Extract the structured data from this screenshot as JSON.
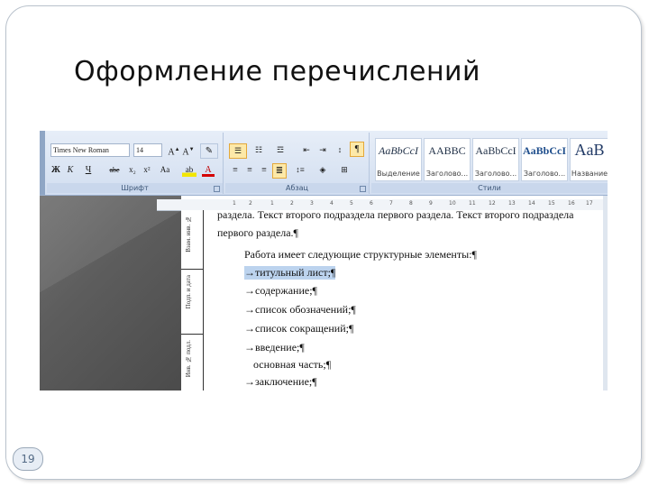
{
  "slide": {
    "title": "Оформление перечислений",
    "page_number": "19"
  },
  "ribbon": {
    "font_name": "Times New Roman",
    "font_size": "14",
    "groups": {
      "font_label": "Шрифт",
      "paragraph_label": "Абзац",
      "styles_label": "Стили"
    },
    "font_row2": [
      "Ж",
      "К",
      "Ч",
      "abe",
      "x₂",
      "x²",
      "Aa"
    ],
    "styles": [
      {
        "preview": "AaBbCcI",
        "name": "Выделение"
      },
      {
        "preview": "AABBC",
        "name": "Заголово..."
      },
      {
        "preview": "AaBbCcI",
        "name": "Заголово..."
      },
      {
        "preview": "AaBbCcI",
        "name": "Заголово..."
      },
      {
        "preview": "AaB",
        "name": "Название"
      }
    ]
  },
  "ruler": {
    "ticks": [
      "1",
      "2",
      "1",
      "2",
      "3",
      "4",
      "5",
      "6",
      "7",
      "8",
      "9",
      "10",
      "11",
      "12",
      "13",
      "14",
      "15",
      "16",
      "17"
    ]
  },
  "document": {
    "lines": [
      "раздела. Текст второго подраздела первого раздела. Текст второго подраздела",
      "первого раздела.¶",
      "Работа имеет следующие структурные элементы:¶",
      "→титульный лист;¶",
      "→содержание;¶",
      "→список обозначений;¶",
      "→список сокращений;¶",
      "→введение;¶",
      "основная часть;¶",
      "→заключение;¶"
    ],
    "side_labels": [
      "Инв. № подл.",
      "Подп. и дата",
      "Взам. инв. №"
    ]
  }
}
